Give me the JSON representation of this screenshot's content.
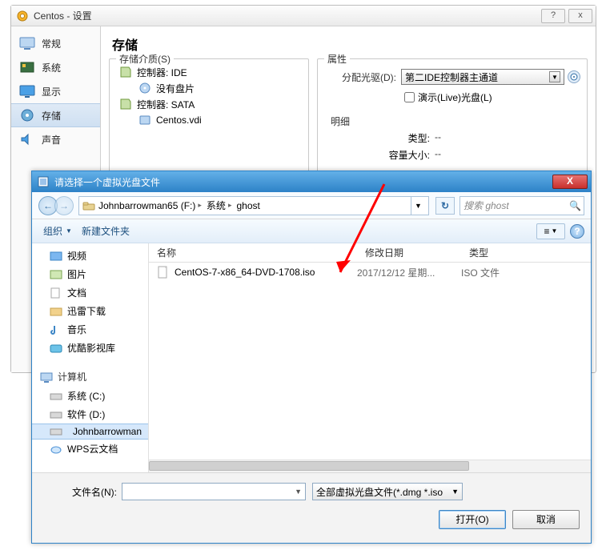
{
  "settings": {
    "title": "Centos - 设置",
    "nav": [
      "常规",
      "系统",
      "显示",
      "存储",
      "声音"
    ],
    "heading": "存储",
    "storage_media_label": "存储介质(S)",
    "tree": {
      "ctrl_ide": "控制器: IDE",
      "ide_child": "没有盘片",
      "ctrl_sata": "控制器: SATA",
      "sata_child": "Centos.vdi"
    },
    "attributes": {
      "legend": "属性",
      "alloc_label": "分配光驱(D):",
      "alloc_value": "第二IDE控制器主通道",
      "live_cd": "演示(Live)光盘(L)"
    },
    "details": {
      "legend": "明细",
      "type_label": "类型:",
      "type_value": "--",
      "size_label": "容量大小:",
      "size_value": "--"
    }
  },
  "dialog": {
    "title": "请选择一个虚拟光盘文件",
    "breadcrumbs": [
      "Johnbarrowman65 (F:)",
      "系统",
      "ghost"
    ],
    "search_placeholder": "搜索 ghost",
    "toolbar": {
      "organize": "组织",
      "newfolder": "新建文件夹"
    },
    "tree": {
      "lib_items": [
        "视频",
        "图片",
        "文档",
        "迅雷下载",
        "音乐",
        "优酷影视库"
      ],
      "computer_label": "计算机",
      "drives": [
        "系统 (C:)",
        "软件 (D:)",
        "Johnbarrowman",
        "WPS云文档"
      ],
      "selected_index": 2
    },
    "columns": {
      "name": "名称",
      "date": "修改日期",
      "type": "类型"
    },
    "file": {
      "name": "CentOS-7-x86_64-DVD-1708.iso",
      "date": "2017/12/12 星期...",
      "type": "ISO 文件"
    },
    "filename_label": "文件名(N):",
    "filename_value": "",
    "filter": "全部虚拟光盘文件(*.dmg *.iso",
    "open_btn": "打开(O)",
    "cancel_btn": "取消"
  }
}
